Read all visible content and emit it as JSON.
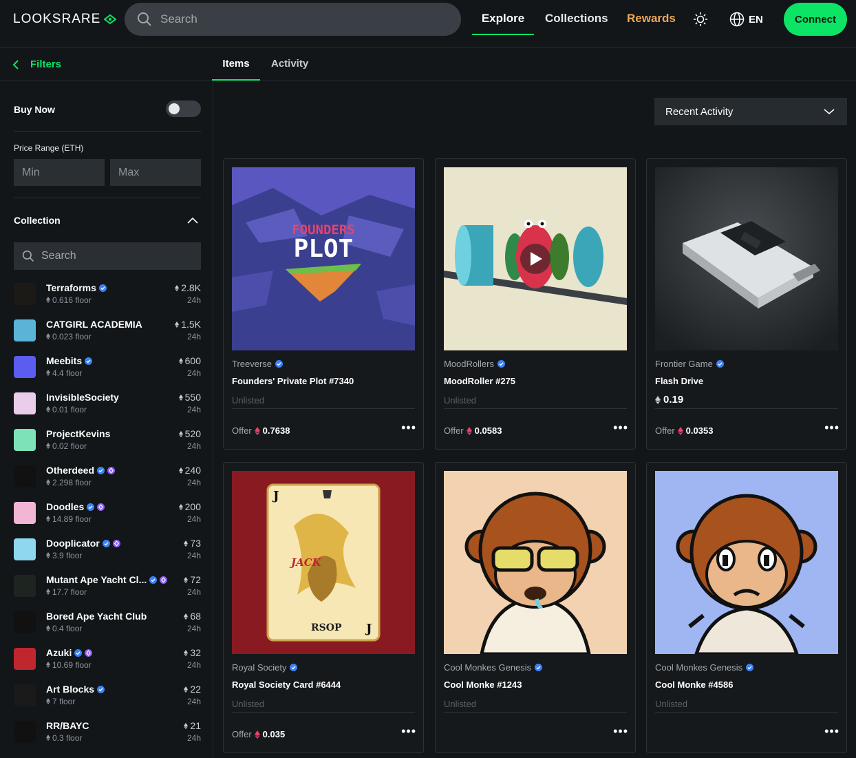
{
  "header": {
    "logo": "LOOKSRARE",
    "search_placeholder": "Search",
    "nav": {
      "explore": "Explore",
      "collections": "Collections",
      "rewards": "Rewards"
    },
    "lang": "EN",
    "connect": "Connect"
  },
  "subbar": {
    "filters": "Filters",
    "tabs": {
      "items": "Items",
      "activity": "Activity"
    }
  },
  "sidebar": {
    "buy_now": "Buy Now",
    "price_range": "Price Range (ETH)",
    "min_placeholder": "Min",
    "max_placeholder": "Max",
    "collection": "Collection",
    "search_placeholder": "Search",
    "collections": [
      {
        "name": "Terraforms",
        "floor": "0.616 floor",
        "volume": "2.8K",
        "period": "24h",
        "color": "#1c1a17"
      },
      {
        "name": "CATGIRL ACADEMIA",
        "floor": "0.023 floor",
        "volume": "1.5K",
        "period": "24h",
        "color": "#5bb3d8"
      },
      {
        "name": "Meebits",
        "floor": "4.4 floor",
        "volume": "600",
        "period": "24h",
        "color": "#5b5cf0"
      },
      {
        "name": "InvisibleSociety",
        "floor": "0.01 floor",
        "volume": "550",
        "period": "24h",
        "color": "#e9cdea"
      },
      {
        "name": "ProjectKevins",
        "floor": "0.02 floor",
        "volume": "520",
        "period": "24h",
        "color": "#7de3b6"
      },
      {
        "name": "Otherdeed",
        "floor": "2.298 floor",
        "volume": "240",
        "period": "24h",
        "color": "#111111"
      },
      {
        "name": "Doodles",
        "floor": "14.89 floor",
        "volume": "200",
        "period": "24h",
        "color": "#f2b5d6"
      },
      {
        "name": "Dooplicator",
        "floor": "3.9 floor",
        "volume": "73",
        "period": "24h",
        "color": "#8fd6ef"
      },
      {
        "name": "Mutant Ape Yacht Cl...",
        "floor": "17.7 floor",
        "volume": "72",
        "period": "24h",
        "color": "#1e2420"
      },
      {
        "name": "Bored Ape Yacht Club",
        "floor": "0.4 floor",
        "volume": "68",
        "period": "24h",
        "color": "#111111"
      },
      {
        "name": "Azuki",
        "floor": "10.69 floor",
        "volume": "32",
        "period": "24h",
        "color": "#c0262d"
      },
      {
        "name": "Art Blocks",
        "floor": "7 floor",
        "volume": "22",
        "period": "24h",
        "color": "#1a1a1a"
      },
      {
        "name": "RR/BAYC",
        "floor": "0.3 floor",
        "volume": "21",
        "period": "24h",
        "color": "#111111"
      }
    ]
  },
  "main": {
    "sort": "Recent Activity",
    "cards": [
      {
        "collection": "Treeverse",
        "title": "Founders' Private Plot #7340",
        "status": "Unlisted",
        "price": "",
        "offer_label": "Offer",
        "offer": "0.7638",
        "img_title_top": "FOUNDERS",
        "img_title_bottom": "PLOT"
      },
      {
        "collection": "MoodRollers",
        "title": "MoodRoller #275",
        "status": "Unlisted",
        "price": "",
        "offer_label": "Offer",
        "offer": "0.0583"
      },
      {
        "collection": "Frontier Game",
        "title": "Flash Drive",
        "status": "",
        "price": "0.19",
        "offer_label": "Offer",
        "offer": "0.0353"
      },
      {
        "collection": "Royal Society",
        "title": "Royal Society Card #6444",
        "status": "Unlisted",
        "price": "",
        "offer_label": "Offer",
        "offer": "0.035",
        "img_card_name": "JACK",
        "img_card_footer": "RSOP"
      },
      {
        "collection": "Cool Monkes Genesis",
        "title": "Cool Monke #1243",
        "status": "Unlisted",
        "price": "",
        "offer_label": "",
        "offer": ""
      },
      {
        "collection": "Cool Monkes Genesis",
        "title": "Cool Monke #4586",
        "status": "Unlisted",
        "price": "",
        "offer_label": "",
        "offer": ""
      }
    ]
  }
}
